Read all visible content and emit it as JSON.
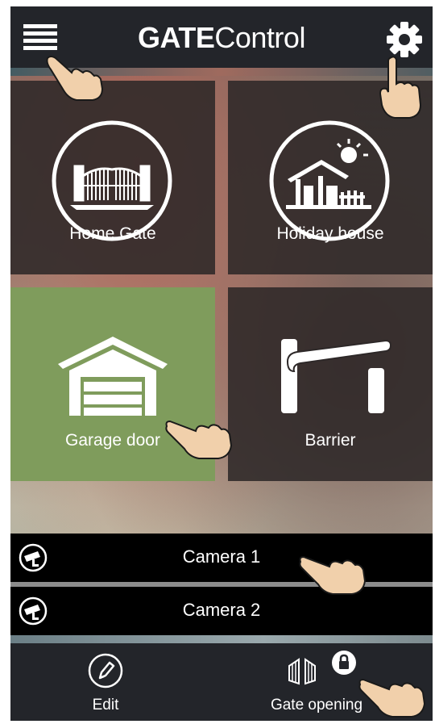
{
  "app": {
    "title_bold": "GATE",
    "title_light": "Control"
  },
  "tiles": [
    {
      "label": "Home Gate",
      "icon": "gate-icon",
      "active": false
    },
    {
      "label": "Holiday house",
      "icon": "holiday-house-icon",
      "active": false
    },
    {
      "label": "Garage door",
      "icon": "garage-icon",
      "active": true
    },
    {
      "label": "Barrier",
      "icon": "barrier-icon",
      "active": false
    }
  ],
  "cameras": [
    {
      "label": "Camera 1",
      "icon": "cctv-camera-icon"
    },
    {
      "label": "Camera 2",
      "icon": "cctv-camera-icon"
    }
  ],
  "bottombar": {
    "edit_label": "Edit",
    "gate_opening_label": "Gate opening"
  },
  "colors": {
    "bar": "#23252a",
    "tile": "#2d2828",
    "active_tile": "#7f9c5c",
    "camera_row": "#000000"
  }
}
